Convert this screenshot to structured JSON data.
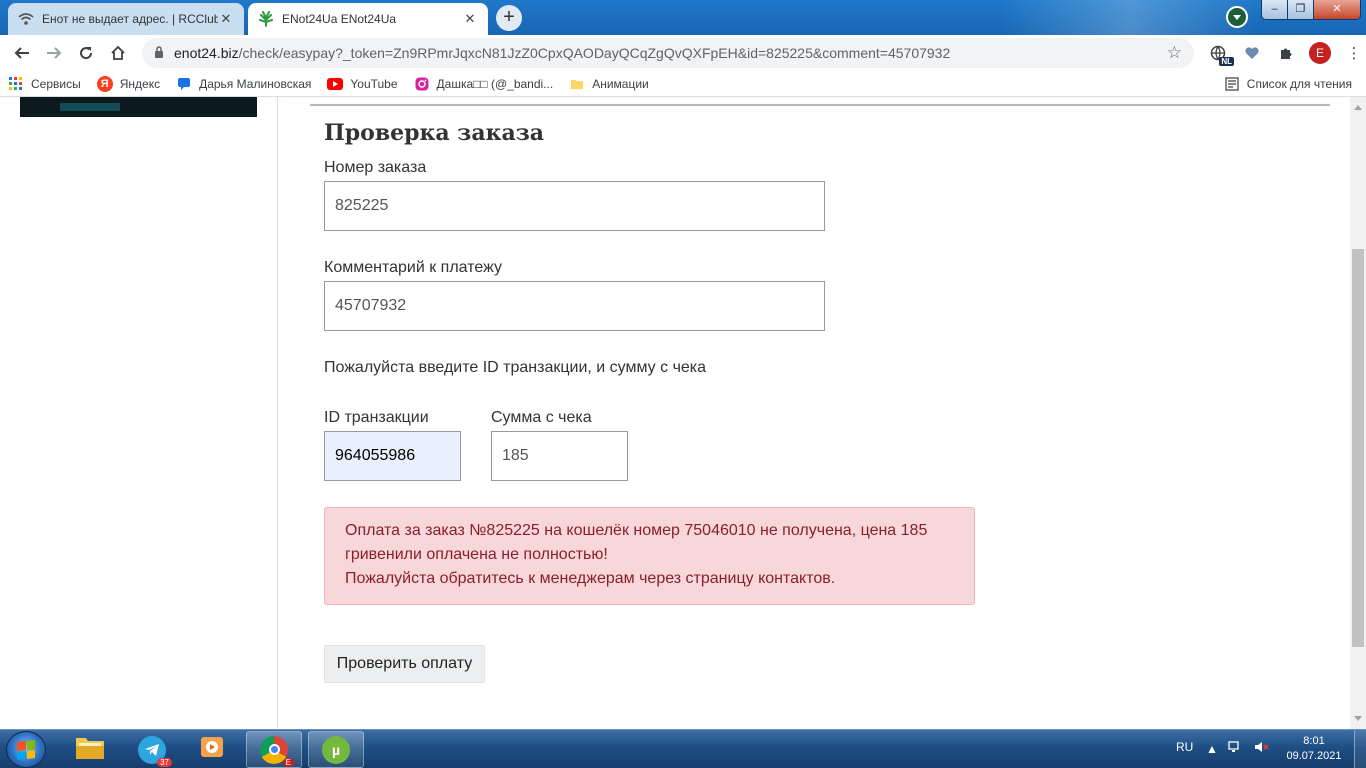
{
  "browser": {
    "tabs": [
      {
        "title": "Енот не выдает адрес. | RCClub",
        "active": false
      },
      {
        "title": "ENot24Ua ENot24Ua",
        "active": true
      }
    ],
    "new_tab_label": "+",
    "url_host": "enot24.biz",
    "url_path": "/check/easypay?_token=Zn9RPmrJqxcN81JzZ0CpxQAODayQCqZgQvQXFpEH&id=825225&comment=45707932",
    "profile_initial": "E",
    "nl_badge": "NL",
    "bookmarks": [
      {
        "label": "Сервисы",
        "icon": "apps-grid-icon"
      },
      {
        "label": "Яндекс",
        "icon": "yandex-icon"
      },
      {
        "label": "Дарья Малиновская",
        "icon": "chat-icon"
      },
      {
        "label": "YouTube",
        "icon": "youtube-icon"
      },
      {
        "label": "Дашка□□ (@_bandi...",
        "icon": "instagram-icon"
      },
      {
        "label": "Анимации",
        "icon": "folder-icon"
      }
    ],
    "reading_list": "Список для чтения"
  },
  "form": {
    "title": "Проверка заказа",
    "order_label": "Номер заказа",
    "order_value": "825225",
    "comment_label": "Комментарий к платежу",
    "comment_value": "45707932",
    "instruction": "Пожалуйста введите ID транзакции, и сумму с чека",
    "txn_label": "ID транзакции",
    "txn_value": "964055986",
    "sum_label": "Сумма с чека",
    "sum_value": "185",
    "alert_line1": "Оплата за заказ №825225 на кошелёк номер 75046010 не получена, цена 185 гривенили оплачена не полностью!",
    "alert_line2": "Пожалуйста обратитесь к менеджерам через страницу контактов.",
    "submit_label": "Проверить оплату"
  },
  "taskbar": {
    "apps": [
      "file-explorer-icon",
      "telegram-icon",
      "media-player-icon",
      "chrome-icon",
      "utorrent-icon"
    ],
    "telegram_badge": "37",
    "chrome_profile": "E",
    "utorrent_letter": "µ",
    "language": "RU",
    "time": "8:01",
    "date": "09.07.2021"
  },
  "colors": {
    "alert_bg": "#f8d7da",
    "alert_text": "#8a1f2b",
    "autofill_bg": "#e8f0fe",
    "taskbar": "#1e4e84"
  }
}
